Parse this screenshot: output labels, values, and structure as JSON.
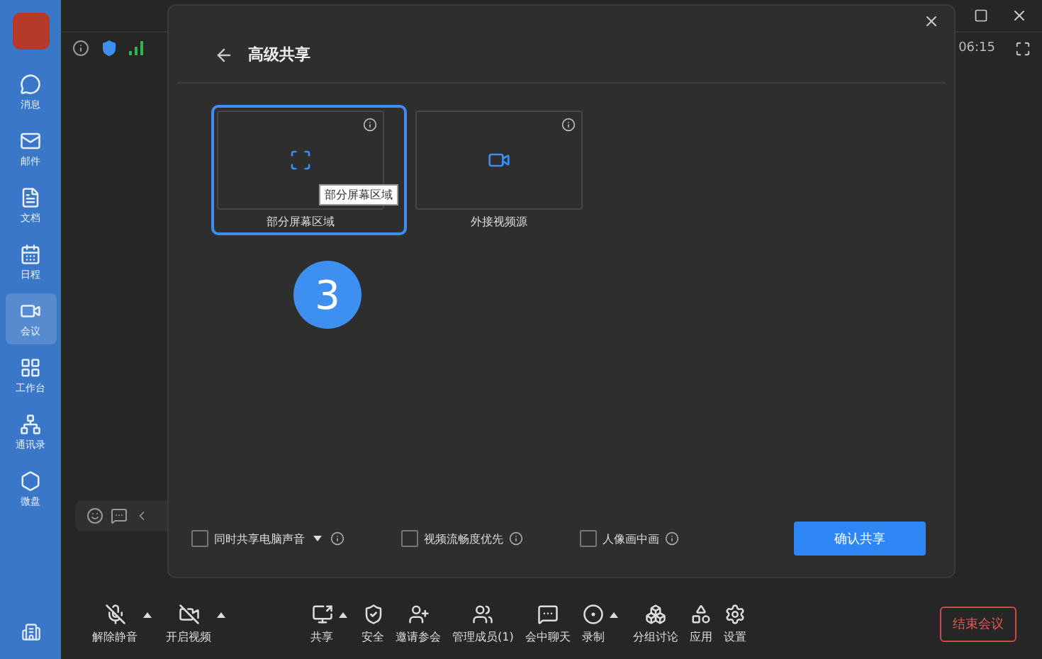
{
  "sidebar": {
    "items": [
      {
        "label": "消息",
        "selected": false
      },
      {
        "label": "邮件",
        "selected": false
      },
      {
        "label": "文档",
        "selected": false
      },
      {
        "label": "日程",
        "selected": false
      },
      {
        "label": "会议",
        "selected": true
      },
      {
        "label": "工作台",
        "selected": false
      },
      {
        "label": "通讯录",
        "selected": false
      },
      {
        "label": "微盘",
        "selected": false
      }
    ]
  },
  "meeting": {
    "time": "06:15"
  },
  "dialog": {
    "title": "高级共享",
    "options": [
      {
        "label": "部分屏幕区域",
        "selected": true,
        "tooltip": "部分屏幕区域"
      },
      {
        "label": "外接视频源",
        "selected": false
      }
    ],
    "checkboxes": [
      {
        "label": "同时共享电脑声音",
        "checked": false,
        "dropdown": true
      },
      {
        "label": "视频流畅度优先",
        "checked": false,
        "dropdown": false
      },
      {
        "label": "人像画中画",
        "checked": false,
        "dropdown": false
      }
    ],
    "confirm": "确认共享"
  },
  "step_badge": "3",
  "toolbar": {
    "items": [
      {
        "label": "解除静音",
        "caret": true
      },
      {
        "label": "开启视频",
        "caret": true
      },
      {
        "label": "共享",
        "caret": true
      },
      {
        "label": "安全",
        "caret": false
      },
      {
        "label": "邀请参会",
        "caret": false
      },
      {
        "label": "管理成员(1)",
        "caret": false
      },
      {
        "label": "会中聊天",
        "caret": false
      },
      {
        "label": "录制",
        "caret": true
      },
      {
        "label": "分组讨论",
        "caret": false
      },
      {
        "label": "应用",
        "caret": false
      },
      {
        "label": "设置",
        "caret": false
      }
    ],
    "end": "结束会议"
  }
}
